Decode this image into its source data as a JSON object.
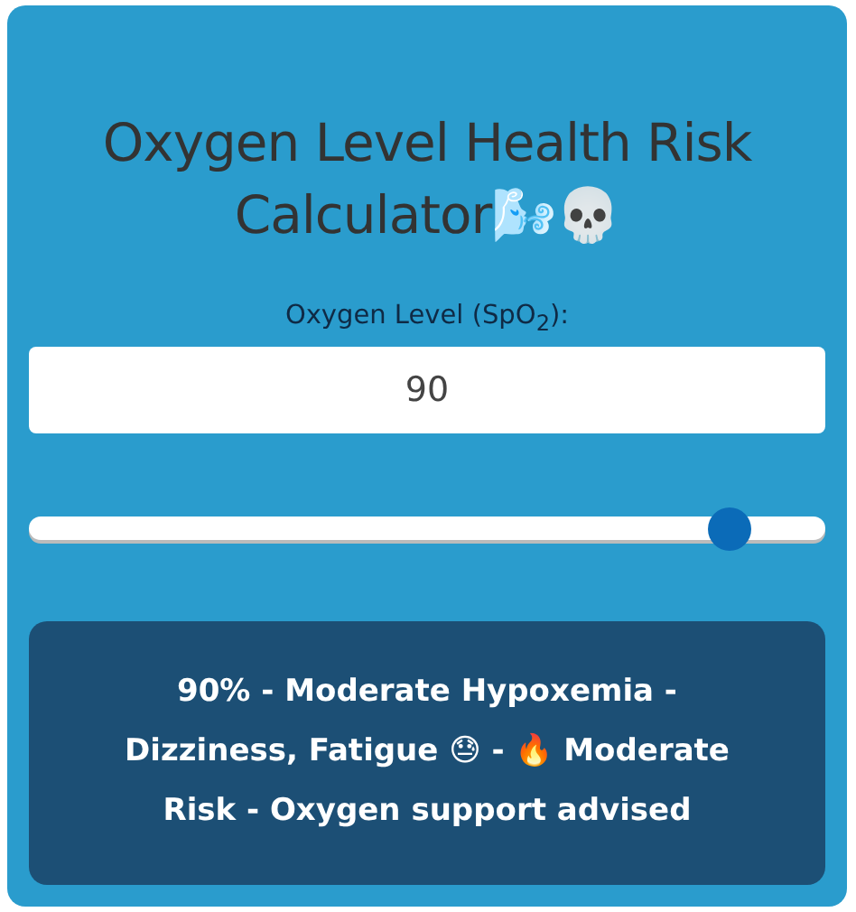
{
  "title": "Oxygen Level Health Risk Calculator🌬️💀",
  "input": {
    "label": "Oxygen Level (SpO$_{2}$):",
    "value": "90"
  },
  "slider": {
    "level": 0.88
  },
  "result": "90% - Moderate Hypoxemia - Dizziness, Fatigue 😓 - 🔥 Moderate Risk - Oxygen support advised"
}
